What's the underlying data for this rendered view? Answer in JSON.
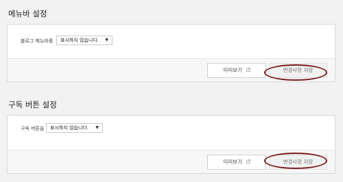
{
  "menubar_section": {
    "title": "메뉴바 설정",
    "field_label": "블로그 메뉴바를",
    "select_value": "표시하지 않습니다.",
    "preview_label": "미리보기",
    "save_label": "변경사항 저장"
  },
  "subscribe_section": {
    "title": "구독 버튼 설정",
    "field_label": "구독 버튼을",
    "select_value": "표시하지 않습니다.",
    "preview_label": "미리보기",
    "save_label": "변경사항 저장"
  },
  "icons": {
    "caret": "caret-down-icon",
    "external": "external-link-icon"
  },
  "colors": {
    "annotation_ellipse": "#7a1a1a",
    "footer_bg": "#f7f7f7"
  }
}
